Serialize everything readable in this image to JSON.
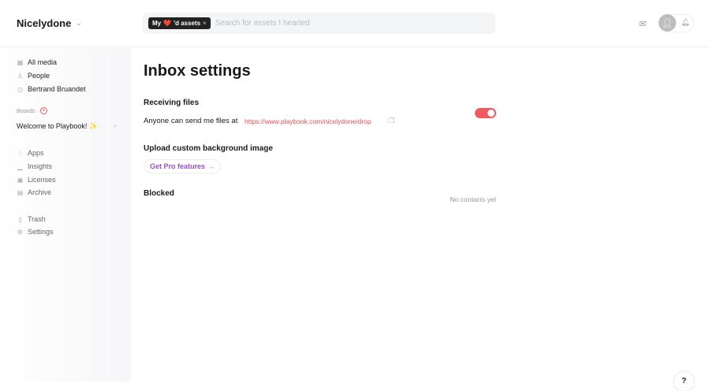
{
  "header": {
    "workspace": "Nicelydone",
    "chip_label_prefix": "My",
    "chip_heart": "❤️",
    "chip_label_suffix": "'d assets",
    "chip_close": "×",
    "search_placeholder": "Search for assets I hearted"
  },
  "sidebar": {
    "top_items": [
      {
        "label": "All media",
        "icon": "▦"
      },
      {
        "label": "People",
        "icon": "♙"
      },
      {
        "label": "Bertrand Bruandet",
        "icon": "◷"
      }
    ],
    "boards_label": "Boards",
    "board": "Welcome to Playbook! ✨",
    "tool_items": [
      {
        "label": "Apps",
        "icon": "⁘"
      },
      {
        "label": "Insights",
        "icon": "▁"
      },
      {
        "label": "Licenses",
        "icon": "▣"
      },
      {
        "label": "Archive",
        "icon": "▤"
      }
    ],
    "bottom_items": [
      {
        "label": "Trash",
        "icon": "▯"
      },
      {
        "label": "Settings",
        "icon": "⚙"
      }
    ]
  },
  "main": {
    "title": "Inbox settings",
    "receiving": {
      "heading": "Receiving files",
      "text": "Anyone can send me files at",
      "url": "https://www.playbook.com/nicelydone/drop",
      "enabled": true
    },
    "upload": {
      "heading": "Upload custom background image",
      "button": "Get Pro features",
      "arrow": "→"
    },
    "blocked": {
      "heading": "Blocked",
      "empty": "No contacts yet"
    }
  },
  "help": "?",
  "colors": {
    "accent": "#f05a5f",
    "pro": "#9b4fc0"
  }
}
